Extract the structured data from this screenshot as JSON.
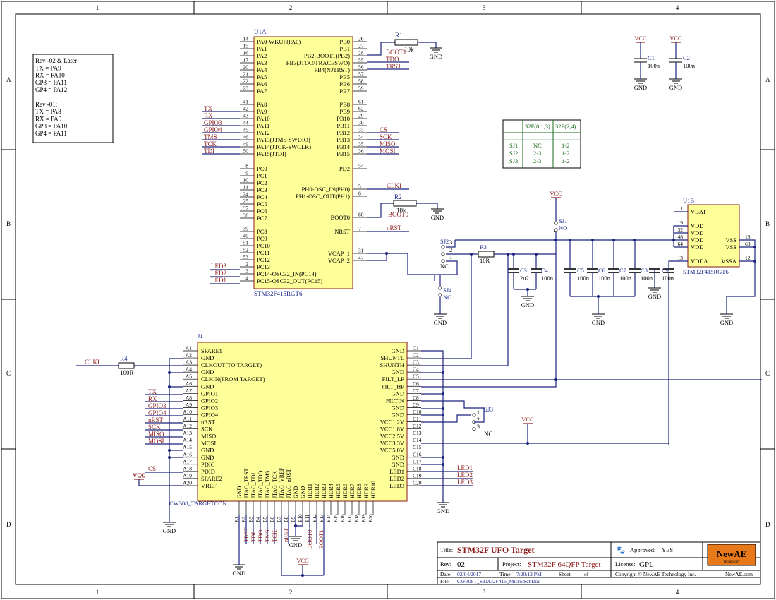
{
  "frame": {
    "columns": [
      "1",
      "2",
      "3",
      "4"
    ],
    "rows": [
      "A",
      "B",
      "C",
      "D"
    ]
  },
  "notes": {
    "lines": [
      "Rev -02 & Later:",
      "TX = PA9",
      "RX = PA10",
      "GP3 = PA11",
      "GP4 = PA12",
      "",
      "Rev -01:",
      "TX = PA8",
      "RX = PA9",
      "GP3 = PA10",
      "GP4 = PA11"
    ]
  },
  "u1a": {
    "designator": "U1A",
    "part": "STM32F415RGT6",
    "left_pins": [
      {
        "num": "14",
        "name": "PA0-WKUP(PA0)"
      },
      {
        "num": "15",
        "name": "PA1"
      },
      {
        "num": "16",
        "name": "PA2"
      },
      {
        "num": "17",
        "name": "PA3"
      },
      {
        "num": "20",
        "name": "PA4"
      },
      {
        "num": "21",
        "name": "PA5"
      },
      {
        "num": "22",
        "name": "PA6"
      },
      {
        "num": "23",
        "name": "PA7"
      },
      {
        "num": "41",
        "name": "PA8"
      },
      {
        "num": "42",
        "name": "PA9"
      },
      {
        "num": "43",
        "name": "PA10"
      },
      {
        "num": "44",
        "name": "PA11"
      },
      {
        "num": "45",
        "name": "PA12"
      },
      {
        "num": "46",
        "name": "PA13(JTMS-SWDIO)"
      },
      {
        "num": "49",
        "name": "PA14(JTCK-SWCLK)"
      },
      {
        "num": "50",
        "name": "PA15(JTDI)"
      },
      {
        "num": "8",
        "name": "PC0"
      },
      {
        "num": "9",
        "name": "PC1"
      },
      {
        "num": "10",
        "name": "PC2"
      },
      {
        "num": "11",
        "name": "PC3"
      },
      {
        "num": "24",
        "name": "PC4"
      },
      {
        "num": "25",
        "name": "PC5"
      },
      {
        "num": "37",
        "name": "PC6"
      },
      {
        "num": "38",
        "name": "PC7"
      },
      {
        "num": "39",
        "name": "PC8"
      },
      {
        "num": "40",
        "name": "PC9"
      },
      {
        "num": "51",
        "name": "PC10"
      },
      {
        "num": "52",
        "name": "PC11"
      },
      {
        "num": "53",
        "name": "PC12"
      },
      {
        "num": "2",
        "name": "PC13"
      },
      {
        "num": "3",
        "name": "PC14-OSC32_IN(PC14)"
      },
      {
        "num": "4",
        "name": "PC15-OSC32_OUT(PC15)"
      }
    ],
    "right_pins": [
      {
        "num": "26",
        "name": "PB0"
      },
      {
        "num": "27",
        "name": "PB1"
      },
      {
        "num": "28",
        "name": "PB2-BOOT1(PB2)"
      },
      {
        "num": "55",
        "name": "PB3(JTDO/TRACESWO)"
      },
      {
        "num": "56",
        "name": "PB4(NJTRST)"
      },
      {
        "num": "57",
        "name": "PB5"
      },
      {
        "num": "58",
        "name": "PB6"
      },
      {
        "num": "59",
        "name": "PB7"
      },
      {
        "num": "61",
        "name": "PB8"
      },
      {
        "num": "62",
        "name": "PB9"
      },
      {
        "num": "29",
        "name": "PB10"
      },
      {
        "num": "30",
        "name": "PB11"
      },
      {
        "num": "33",
        "name": "PB12"
      },
      {
        "num": "34",
        "name": "PB13"
      },
      {
        "num": "35",
        "name": "PB14"
      },
      {
        "num": "36",
        "name": "PB15"
      },
      {
        "num": "54",
        "name": "PD2"
      },
      {
        "num": "5",
        "name": "PH0-OSC_IN(PH0)"
      },
      {
        "num": "6",
        "name": "PH1-OSC_OUT(PH1)"
      },
      {
        "num": "60",
        "name": "BOOT0"
      },
      {
        "num": "7",
        "name": "NRST"
      },
      {
        "num": "31",
        "name": "VCAP_1"
      },
      {
        "num": "47",
        "name": "VCAP_2"
      }
    ],
    "left_nets": [
      "TX",
      "RX",
      "GPIO3",
      "GPIO4",
      "TMS",
      "TCK",
      "TDI",
      "LED3",
      "LED2",
      "LED1"
    ],
    "right_nets": [
      "BOOT1",
      "TDO",
      "TRST",
      "CS",
      "SCK",
      "MISO",
      "MOSI",
      "CLKI",
      "BOOT0",
      "nRST"
    ]
  },
  "u1b": {
    "designator": "U1B",
    "part": "STM32F415RGT6",
    "pins": [
      {
        "num": "1",
        "name": "VBAT"
      },
      {
        "num": "19",
        "name": "VDD"
      },
      {
        "num": "32",
        "name": "VDD"
      },
      {
        "num": "48",
        "name": "VDD"
      },
      {
        "num": "64",
        "name": "VDD"
      },
      {
        "num": "13",
        "name": "VDDA"
      },
      {
        "num": "18",
        "name": "VSS"
      },
      {
        "num": "63",
        "name": "VSS"
      },
      {
        "num": "12",
        "name": "VSSA"
      }
    ]
  },
  "resistors": [
    {
      "ref": "R1",
      "value": "10k"
    },
    {
      "ref": "R2",
      "value": "10k"
    },
    {
      "ref": "R3",
      "value": "10R"
    },
    {
      "ref": "R4",
      "value": "100R"
    }
  ],
  "capacitors": [
    {
      "ref": "C1",
      "value": "100n"
    },
    {
      "ref": "C2",
      "value": "100n"
    },
    {
      "ref": "C3",
      "value": "2u2"
    },
    {
      "ref": "C4",
      "value": "100n"
    },
    {
      "ref": "C5",
      "value": "100n"
    },
    {
      "ref": "C6",
      "value": "100n"
    },
    {
      "ref": "C7",
      "value": "100n"
    },
    {
      "ref": "C8",
      "value": "100n"
    },
    {
      "ref": "C9",
      "value": "100n"
    }
  ],
  "jumpers": {
    "sj1": {
      "ref": "SJ1",
      "state": "NO"
    },
    "sj2": {
      "ref": "SJ2",
      "state": "NC"
    },
    "sj3": {
      "ref": "SJ3",
      "state": "NC"
    },
    "sj4": {
      "ref": "SJ4",
      "state": "NO"
    }
  },
  "sj_table": {
    "headers": [
      "",
      "32F(0,1,3)",
      "32F(2,4)"
    ],
    "rows": [
      [
        "SJ1",
        "NC",
        "1-2"
      ],
      [
        "SJ2",
        "2-3",
        "1-2"
      ],
      [
        "SJ3",
        "2-3",
        "1-2"
      ]
    ]
  },
  "power": {
    "vcc": "VCC",
    "gnd": "GND"
  },
  "j1": {
    "designator": "J1",
    "footprint": "CW308_TARGETCON",
    "a_pins": [
      {
        "num": "A1",
        "name": "SPARE1"
      },
      {
        "num": "A2",
        "name": "GND"
      },
      {
        "num": "A3",
        "name": "CLKOUT(TO TARGET)"
      },
      {
        "num": "A4",
        "name": "GND"
      },
      {
        "num": "A5",
        "name": "CLKIN(FROM TARGET)"
      },
      {
        "num": "A6",
        "name": "GND"
      },
      {
        "num": "A7",
        "name": "GPIO1"
      },
      {
        "num": "A8",
        "name": "GPIO2"
      },
      {
        "num": "A9",
        "name": "GPIO3"
      },
      {
        "num": "A10",
        "name": "GPIO4"
      },
      {
        "num": "A11",
        "name": "nRST"
      },
      {
        "num": "A12",
        "name": "SCK"
      },
      {
        "num": "A13",
        "name": "MISO"
      },
      {
        "num": "A14",
        "name": "MOSI"
      },
      {
        "num": "A15",
        "name": "GND"
      },
      {
        "num": "A16",
        "name": "GND"
      },
      {
        "num": "A17",
        "name": "PDIC"
      },
      {
        "num": "A18",
        "name": "PDID"
      },
      {
        "num": "A19",
        "name": "SPARE2"
      },
      {
        "num": "A20",
        "name": "VREF"
      }
    ],
    "c_pins": [
      {
        "num": "C1",
        "name": "GND"
      },
      {
        "num": "C2",
        "name": "SHUNTL"
      },
      {
        "num": "C3",
        "name": "SHUNTH"
      },
      {
        "num": "C4",
        "name": "GND"
      },
      {
        "num": "C5",
        "name": "FILT_LP"
      },
      {
        "num": "C6",
        "name": "FILT_HP"
      },
      {
        "num": "C7",
        "name": "GND"
      },
      {
        "num": "C8",
        "name": "FILTIN"
      },
      {
        "num": "C9",
        "name": "GND"
      },
      {
        "num": "C10",
        "name": "GND"
      },
      {
        "num": "C11",
        "name": "VCC1.2V"
      },
      {
        "num": "C12",
        "name": "VCC1.8V"
      },
      {
        "num": "C13",
        "name": "VCC2.5V"
      },
      {
        "num": "C14",
        "name": "VCC3.3V"
      },
      {
        "num": "C15",
        "name": "VCC5.0V"
      },
      {
        "num": "C16",
        "name": "GND"
      },
      {
        "num": "C17",
        "name": "GND"
      },
      {
        "num": "C18",
        "name": "LED1"
      },
      {
        "num": "C19",
        "name": "LED2"
      },
      {
        "num": "C20",
        "name": "LED3"
      }
    ],
    "b_pins": [
      {
        "num": "B1",
        "name": "GND"
      },
      {
        "num": "B2",
        "name": "JTAG_TRST"
      },
      {
        "num": "B3",
        "name": "JTAG_TDI"
      },
      {
        "num": "B4",
        "name": "JTAG_TDO"
      },
      {
        "num": "B5",
        "name": "JTAG_TMS"
      },
      {
        "num": "B6",
        "name": "JTAG_TCK"
      },
      {
        "num": "B7",
        "name": "JTAG_VREF"
      },
      {
        "num": "B8",
        "name": "JTAG_nRST"
      },
      {
        "num": "B9",
        "name": "GND"
      },
      {
        "num": "B10",
        "name": "GND"
      },
      {
        "num": "B11",
        "name": "HDR1"
      },
      {
        "num": "B12",
        "name": "HDR2"
      },
      {
        "num": "B13",
        "name": "HDR3"
      },
      {
        "num": "B14",
        "name": "HDR4"
      },
      {
        "num": "B15",
        "name": "HDR5"
      },
      {
        "num": "B16",
        "name": "HDR6"
      },
      {
        "num": "B17",
        "name": "HDR7"
      },
      {
        "num": "B18",
        "name": "HDR8"
      },
      {
        "num": "B19",
        "name": "HDR9"
      },
      {
        "num": "B20",
        "name": "HDR10"
      }
    ],
    "a_nets": [
      "TX",
      "RX",
      "GPIO3",
      "GPIO4",
      "nRST",
      "SCK",
      "MISO",
      "MOSI",
      "CS",
      "VCC"
    ],
    "b_nets": [
      "TRST",
      "TDI",
      "TDO",
      "TMS",
      "TCK",
      "nRST",
      "BOOT0",
      "BOOT1"
    ],
    "c_nets": [
      "LED1",
      "LED2",
      "LED3"
    ],
    "clk_net": "CLKI",
    "sj3_state": "NC"
  },
  "title_block": {
    "title_label": "Title:",
    "title": "STM32F UFO Target",
    "approved_label": "Approved:",
    "approved": "YES",
    "rev_label": "Rev:",
    "rev": "02",
    "project_label": "Project:",
    "project": "STM32F 64QFP Target",
    "license_label": "License:",
    "license": "GPL",
    "date_label": "Date:",
    "date": "02/04/2017",
    "time_label": "Time:",
    "time": "7:20:12 PM",
    "sheet_label": "Sheet",
    "of_label": "of",
    "copyright": "Copyright © NewAE Technology Inc.",
    "website": "NewAE.com",
    "file_label": "File:",
    "file": "CW308T_STM32F415_Micro.SchDoc",
    "logo_text": "NewAE",
    "logo_sub": "Technology"
  }
}
